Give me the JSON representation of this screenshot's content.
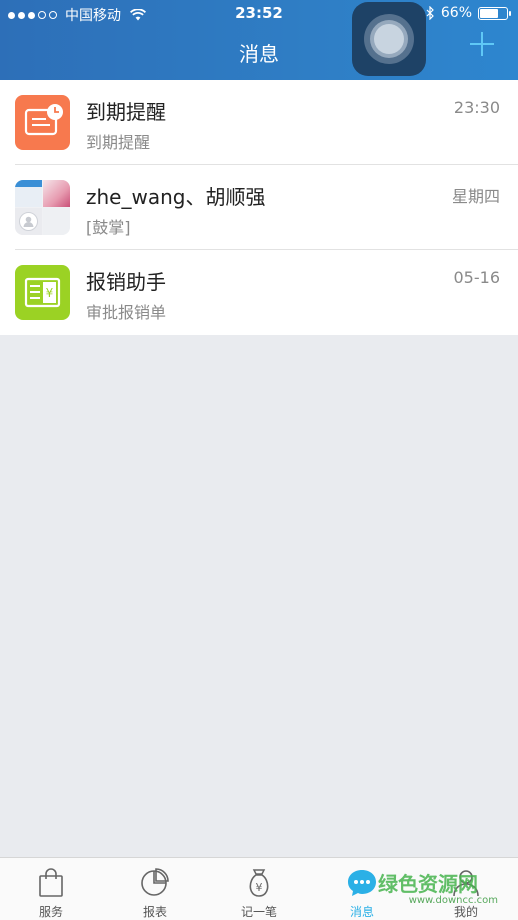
{
  "status_bar": {
    "carrier": "中国移动",
    "time": "23:52",
    "battery": "66%",
    "battery_level": 0.66
  },
  "header": {
    "title": "消息"
  },
  "messages": [
    {
      "name": "到期提醒",
      "preview": "到期提醒",
      "time": "23:30",
      "avatar_icon": "reminder-clock-icon",
      "avatar_color": "#f7794e"
    },
    {
      "name": "zhe_wang、胡顺强",
      "preview": "[鼓掌]",
      "time": "星期四",
      "avatar_icon": "group-avatar-icon"
    },
    {
      "name": "报销助手",
      "preview": "审批报销单",
      "time": "05-16",
      "avatar_icon": "expense-receipt-icon",
      "avatar_color": "#9bd224"
    }
  ],
  "tabs": [
    {
      "label": "服务",
      "icon": "shopping-bag-icon"
    },
    {
      "label": "报表",
      "icon": "pie-chart-icon"
    },
    {
      "label": "记一笔",
      "icon": "money-bag-icon"
    },
    {
      "label": "消息",
      "icon": "chat-bubble-icon",
      "active": true
    },
    {
      "label": "我的",
      "icon": "person-icon"
    }
  ],
  "colors": {
    "header_bg": "#2f7ec5",
    "accent": "#2bb0e6",
    "page_bg": "#e9ebef"
  },
  "watermark": {
    "text": "绿色资源网",
    "url": "www.downcc.com"
  }
}
